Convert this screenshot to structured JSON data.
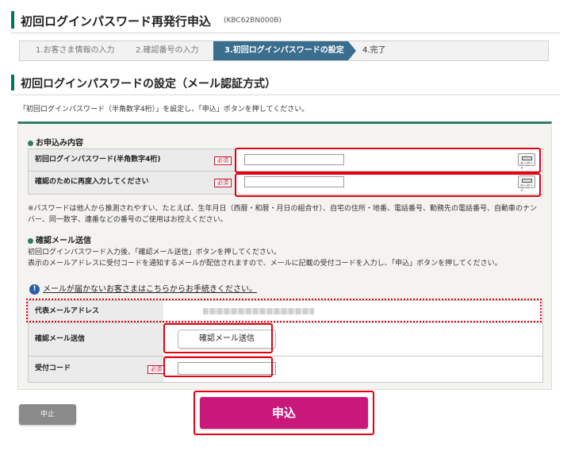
{
  "header": {
    "title": "初回ログインパスワード再発行申込",
    "code": "(KBC62BN000B)"
  },
  "steps": [
    {
      "label": "1.お客さま情報の入力"
    },
    {
      "label": "2.確認番号の入力"
    },
    {
      "label": "3.初回ログインパスワードの設定"
    },
    {
      "label": "4.完了"
    }
  ],
  "section": {
    "title": "初回ログインパスワードの設定（メール認証方式）",
    "intro": "「初回ログインパスワード（半角数字4桁）」を設定し、「申込」ボタンを押してください。"
  },
  "form": {
    "heading": "お申込み内容",
    "required_label": "必須",
    "keyboard_label": "キーボード",
    "rows": [
      {
        "label": "初回ログインパスワード(半角数字4桁)"
      },
      {
        "label": "確認のために再度入力してください"
      }
    ],
    "note": "※パスワードは他人から推測されやすい、たとえば、生年月日（西暦・和暦・月日の組合せ）、自宅の住所・地番、電話番号、勤務先の電話番号、自動車のナンバー、同一数字、連番などの番号のご使用はお控えください。"
  },
  "mail": {
    "heading": "確認メール送信",
    "desc_line1": "初回ログインパスワード入力後、「確認メール送信」ボタンを押してください。",
    "desc_line2": "表示のメールアドレスに受付コードを通知するメールが配信されますので、メールに記載の受付コードを入力し、「申込」ボタンを押してください。",
    "info_link": "メールが届かないお客さまはこちらからお手続きください。",
    "address_label": "代表メールアドレス",
    "send_label": "確認メール送信",
    "send_button": "確認メール送信",
    "code_label": "受付コード"
  },
  "actions": {
    "cancel": "中止",
    "submit": "申込"
  },
  "colors": {
    "accent_green": "#00785a",
    "step_active": "#3a6e8e",
    "submit": "#c9187a",
    "highlight": "#e60012"
  }
}
